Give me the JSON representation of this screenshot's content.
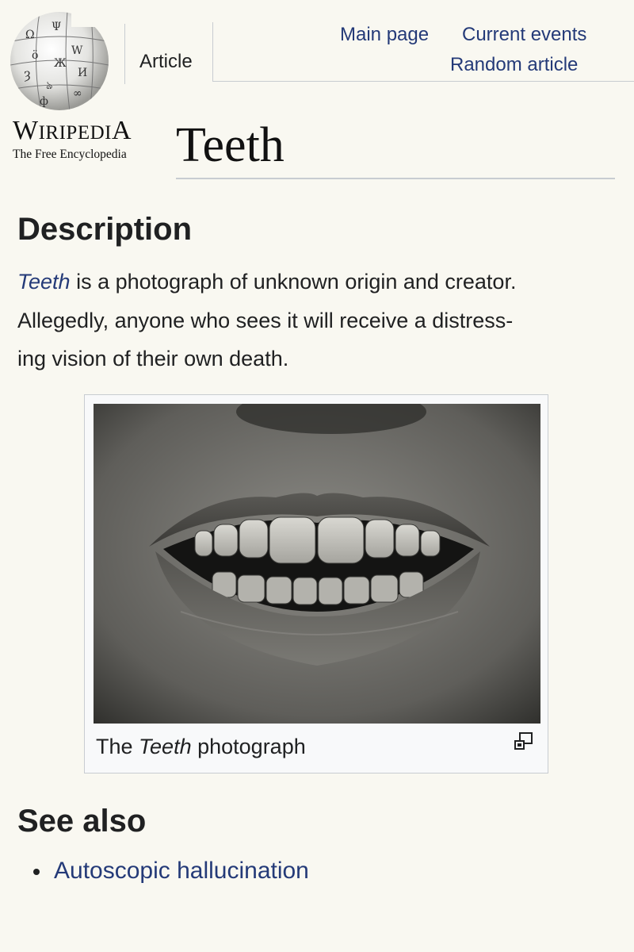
{
  "header": {
    "logo_name_first": "W",
    "logo_name_middle": "IRIPEDI",
    "logo_name_last": "A",
    "logo_tagline": "The Free Encyclopedia",
    "tab_article": "Article",
    "nav": {
      "main_page": "Main page",
      "current_events": "Current events",
      "random_article": "Random article"
    }
  },
  "article": {
    "title": "Teeth",
    "description_heading": "Description",
    "description_link": "Teeth",
    "description_line1_rest": " is a photograph of unknown origin and creator.",
    "description_line2": "Allegedly, anyone who sees it will receive a distress-",
    "description_line3": "ing vision of their own death.",
    "figure": {
      "caption_prefix": "The ",
      "caption_italic": "Teeth",
      "caption_suffix": " photograph"
    },
    "see_also_heading": "See also",
    "see_also_items": [
      "Autoscopic hallucination"
    ]
  },
  "colors": {
    "background": "#f9f8f1",
    "link": "#243a78",
    "text": "#202122",
    "border": "#c8ccd1"
  },
  "icons": {
    "logo": "puzzle-globe-icon",
    "enlarge": "magnify-icon",
    "bullet": "bullet-icon"
  }
}
